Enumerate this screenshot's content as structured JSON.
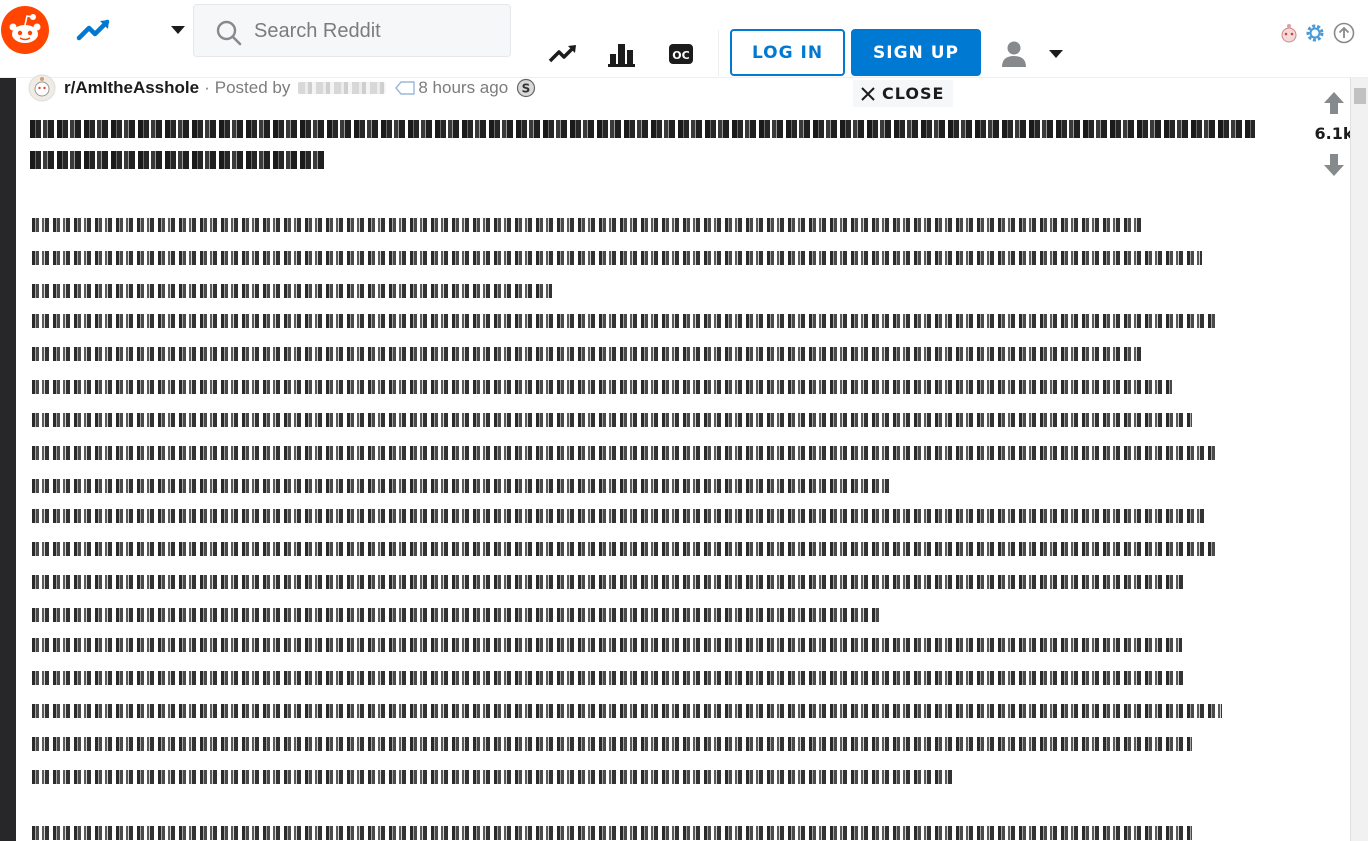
{
  "header": {
    "search_placeholder": "Search Reddit",
    "login_label": "LOG IN",
    "signup_label": "SIGN UP",
    "nav_icons": [
      "trending-icon",
      "popular-icon",
      "oc-icon"
    ]
  },
  "post": {
    "subreddit": "r/AmItheAsshole",
    "posted_by_label": "Posted by",
    "time_ago": "8 hours ago",
    "close_label": "CLOSE",
    "score": "6.1k"
  },
  "colors": {
    "accent": "#0079d3",
    "reddit_orange": "#ff4500",
    "leftbar": "#272729"
  }
}
